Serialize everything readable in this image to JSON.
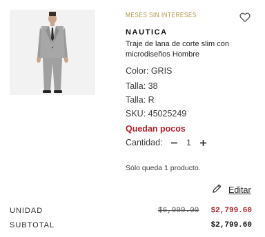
{
  "product": {
    "promo": "MESES SIN INTERESES",
    "brand": "NAUTICA",
    "name": "Traje de lana de corte slim con microdiseños Hombre",
    "color": "Color: GRIS",
    "talla_1": "Talla: 38",
    "talla_2": "Talla: R",
    "sku": "SKU: 45025249",
    "stock_status": "Quedan pocos",
    "image_icon": "suit-photo"
  },
  "quantity": {
    "label": "Cantidad:",
    "value": "1",
    "decrement_icon": "minus-icon",
    "increment_icon": "plus-icon"
  },
  "remaining_note": "Sólo queda 1 producto.",
  "edit": {
    "label": "Editar",
    "icon": "pencil-icon"
  },
  "pricing": {
    "unit_label": "UNIDAD",
    "original_price": "$6,999.00",
    "sale_price": "$2,799.60",
    "subtotal_label": "SUBTOTAL",
    "subtotal_price": "$2,799.60"
  },
  "colors": {
    "accent_gold": "#b09548",
    "sale_red": "#b3202a",
    "text": "#2b2b2b"
  }
}
